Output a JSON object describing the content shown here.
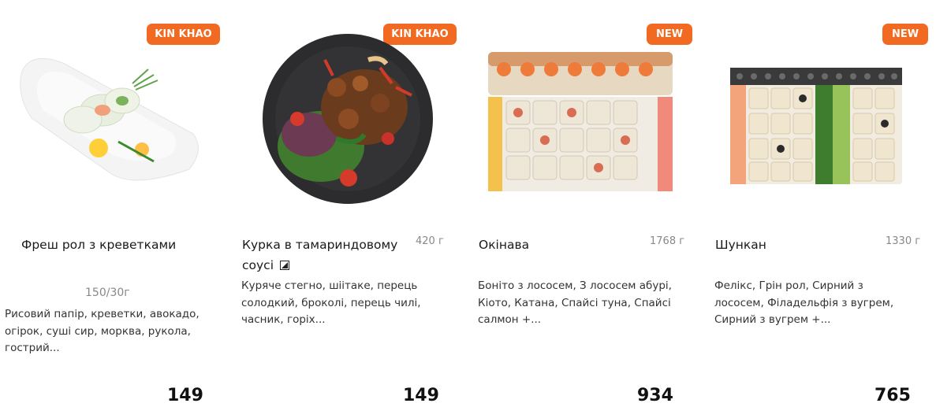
{
  "products": [
    {
      "badge": "KIN KHAO",
      "name": "Фреш рол з креветками",
      "name_icon": "",
      "weight": "150/30г",
      "description": "Рисовий папір, креветки, авокадо, огірок, суші сир, морква, рукола, гострий...",
      "price": "149",
      "image": "fresh-roll-plate-image"
    },
    {
      "badge": "KIN KHAO",
      "name": "Курка в тамариндовому соусі",
      "name_icon": "chili-indicator-icon",
      "weight": "420 г",
      "description": "Куряче стегно, шіітаке, перець солодкий, броколі, перець чилі, часник, горіх...",
      "price": "149",
      "image": "tamarind-chicken-bowl-image"
    },
    {
      "badge": "NEW",
      "name": "Окінава",
      "name_icon": "",
      "weight": "1768 г",
      "description": "Боніто з лососем, З лососем абурі, Кіото, Катана, Спайсі туна, Спайсі салмон +...",
      "price": "934",
      "image": "okinawa-sushi-set-image"
    },
    {
      "badge": "NEW",
      "name": "Шункан",
      "name_icon": "",
      "weight": "1330 г",
      "description": "Фелікс, Грін рол, Сирний з лососем, Філадельфія з вугрем, Сирний з вугрем +...",
      "price": "765",
      "image": "shunkan-sushi-set-image"
    }
  ],
  "colors": {
    "badge": "#f26a21",
    "text": "#1a1a1a",
    "muted": "#888888"
  }
}
